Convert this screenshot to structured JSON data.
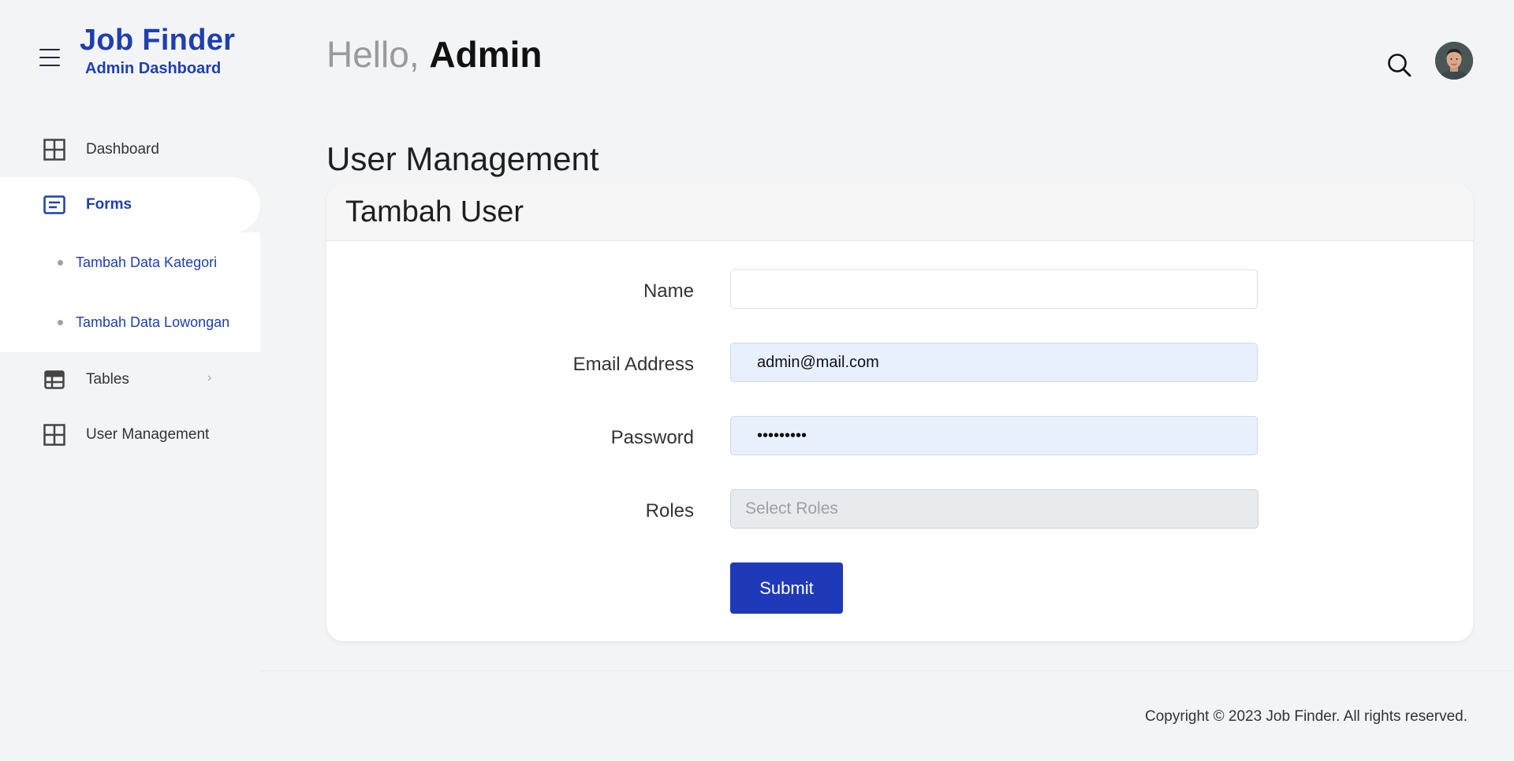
{
  "brand": {
    "title": "Job Finder",
    "subtitle": "Admin Dashboard"
  },
  "sidebar": {
    "items": [
      {
        "label": "Dashboard",
        "icon": "grid-icon"
      },
      {
        "label": "Forms",
        "icon": "form-icon",
        "active": true
      },
      {
        "label": "Tables",
        "icon": "table-icon"
      },
      {
        "label": "User Management",
        "icon": "grid-icon"
      }
    ],
    "forms_sub": [
      {
        "label": "Tambah Data Kategori"
      },
      {
        "label": "Tambah Data Lowongan"
      }
    ]
  },
  "header": {
    "greeting": "Hello,",
    "user": "Admin"
  },
  "main": {
    "page_title": "User Management",
    "card_title": "Tambah User",
    "form": {
      "name_label": "Name",
      "name_value": "",
      "email_label": "Email Address",
      "email_value": "admin@mail.com",
      "password_label": "Password",
      "password_value": "•••••••••",
      "roles_label": "Roles",
      "roles_placeholder": "Select Roles",
      "submit_label": "Submit"
    }
  },
  "footer": {
    "copyright": "Copyright © 2023 Job Finder. All rights reserved."
  },
  "colors": {
    "accent": "#1e3fae",
    "button": "#1e3ab8",
    "background": "#f3f4f6",
    "filled_input": "#e8f0fe"
  }
}
